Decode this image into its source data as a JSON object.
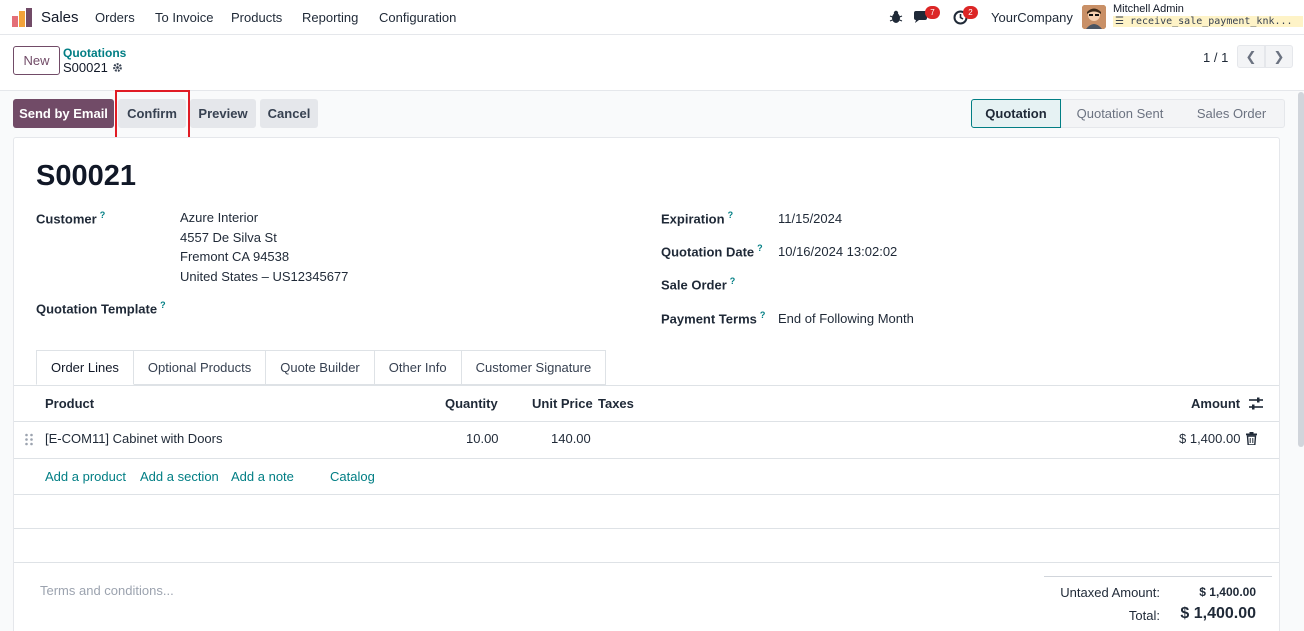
{
  "navbar": {
    "app_name": "Sales",
    "menu": [
      "Orders",
      "To Invoice",
      "Products",
      "Reporting",
      "Configuration"
    ],
    "messages_badge": "7",
    "activities_badge": "2",
    "company": "YourCompany",
    "user_name": "Mitchell Admin",
    "database": "receive_sale_payment_knk..."
  },
  "control_panel": {
    "new_label": "New",
    "breadcrumb_parent": "Quotations",
    "breadcrumb_current": "S00021",
    "pager": "1 / 1"
  },
  "actions": {
    "send_by_email": "Send by Email",
    "confirm": "Confirm",
    "preview": "Preview",
    "cancel": "Cancel"
  },
  "status": {
    "stages": [
      "Quotation",
      "Quotation Sent",
      "Sales Order"
    ],
    "active": "Quotation"
  },
  "form": {
    "name": "S00021",
    "customer_label": "Customer",
    "customer_lines": [
      "Azure Interior",
      "4557 De Silva St",
      "Fremont CA 94538",
      "United States – US12345677"
    ],
    "quotation_template_label": "Quotation Template",
    "expiration_label": "Expiration",
    "expiration_value": "11/15/2024",
    "quotation_date_label": "Quotation Date",
    "quotation_date_value": "10/16/2024 13:02:02",
    "sale_order_label": "Sale Order",
    "payment_terms_label": "Payment Terms",
    "payment_terms_value": "End of Following Month",
    "help_marker": "?"
  },
  "tabs": [
    "Order Lines",
    "Optional Products",
    "Quote Builder",
    "Other Info",
    "Customer Signature"
  ],
  "order_lines": {
    "columns": [
      "Product",
      "Quantity",
      "Unit Price",
      "Taxes",
      "Amount"
    ],
    "rows": [
      {
        "product": "[E-COM11] Cabinet with Doors",
        "quantity": "10.00",
        "unit_price": "140.00",
        "taxes": "",
        "amount": "$ 1,400.00"
      }
    ],
    "add_product": "Add a product",
    "add_section": "Add a section",
    "add_note": "Add a note",
    "catalog": "Catalog"
  },
  "footer": {
    "terms_placeholder": "Terms and conditions...",
    "untaxed_label": "Untaxed Amount:",
    "untaxed_value": "$ 1,400.00",
    "total_label": "Total:",
    "total_value": "$ 1,400.00"
  },
  "colors": {
    "primary": "#714b67",
    "link": "#017e84",
    "highlight": "#e01b24",
    "badge": "#dc2626"
  }
}
